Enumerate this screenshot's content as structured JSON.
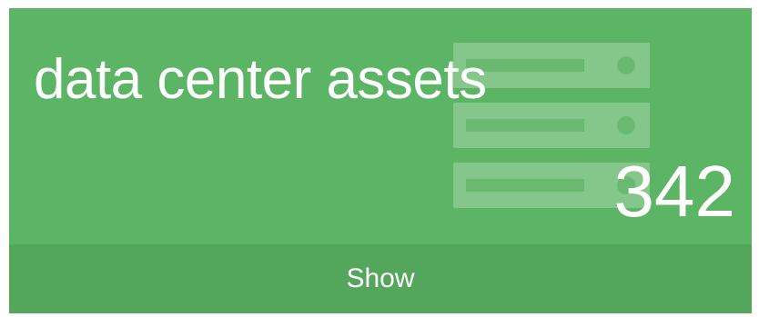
{
  "tile": {
    "title": "data center assets",
    "count": "342",
    "action_label": "Show",
    "icon": "server-icon",
    "colors": {
      "background": "#5cb565",
      "footer": "#55a65d",
      "text": "#ffffff"
    }
  }
}
